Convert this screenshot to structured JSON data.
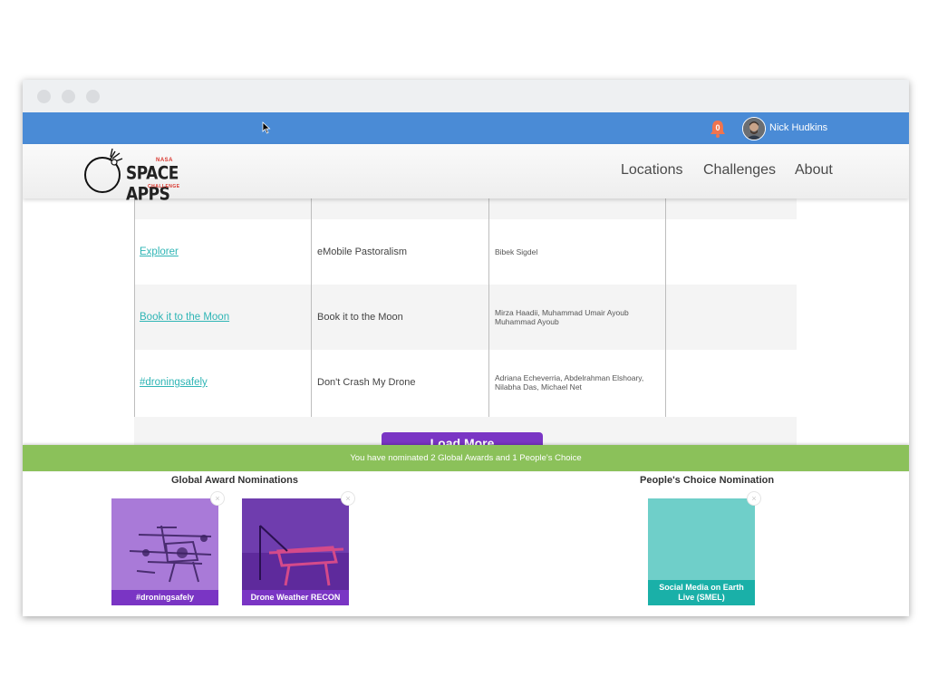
{
  "header": {
    "notification_count": "0",
    "user_name": "Nick Hudkins"
  },
  "logo": {
    "nasa": "NASA",
    "name": "SPACE APPS",
    "challenge": "CHALLENGE"
  },
  "nav": {
    "locations": "Locations",
    "challenges": "Challenges",
    "about": "About"
  },
  "table": {
    "rows": [
      {
        "project": "Explorer",
        "challenge": "eMobile Pastoralism",
        "team": "Bibek Sigdel"
      },
      {
        "project": "Book it to the Moon",
        "challenge": "Book it to the Moon",
        "team": "Mirza Haadii, Muhammad Umair Ayoub Muhammad Ayoub"
      },
      {
        "project": "#droningsafely",
        "challenge": "Don't Crash My Drone",
        "team": "Adriana Echeverria, Abdelrahman Elshoary, Nilabha Das, Michael Net"
      }
    ],
    "load_more_label": "Load More"
  },
  "nominations": {
    "banner": "You have nominated 2 Global Awards and 1 People's Choice",
    "global_title": "Global Award Nominations",
    "peoples_title": "People's Choice Nomination",
    "global": [
      {
        "label": "#droningsafely"
      },
      {
        "label": "Drone Weather RECON"
      }
    ],
    "peoples": [
      {
        "label": "Social Media on Earth Live (SMEL)"
      }
    ],
    "remove_glyph": "×"
  },
  "colors": {
    "topbar": "#4a8bd6",
    "banner": "#8bc15a",
    "link": "#2fb5b5",
    "purple": "#7a35c4",
    "teal_card": "#6fcfc9",
    "teal_label": "#1ab0a8"
  }
}
